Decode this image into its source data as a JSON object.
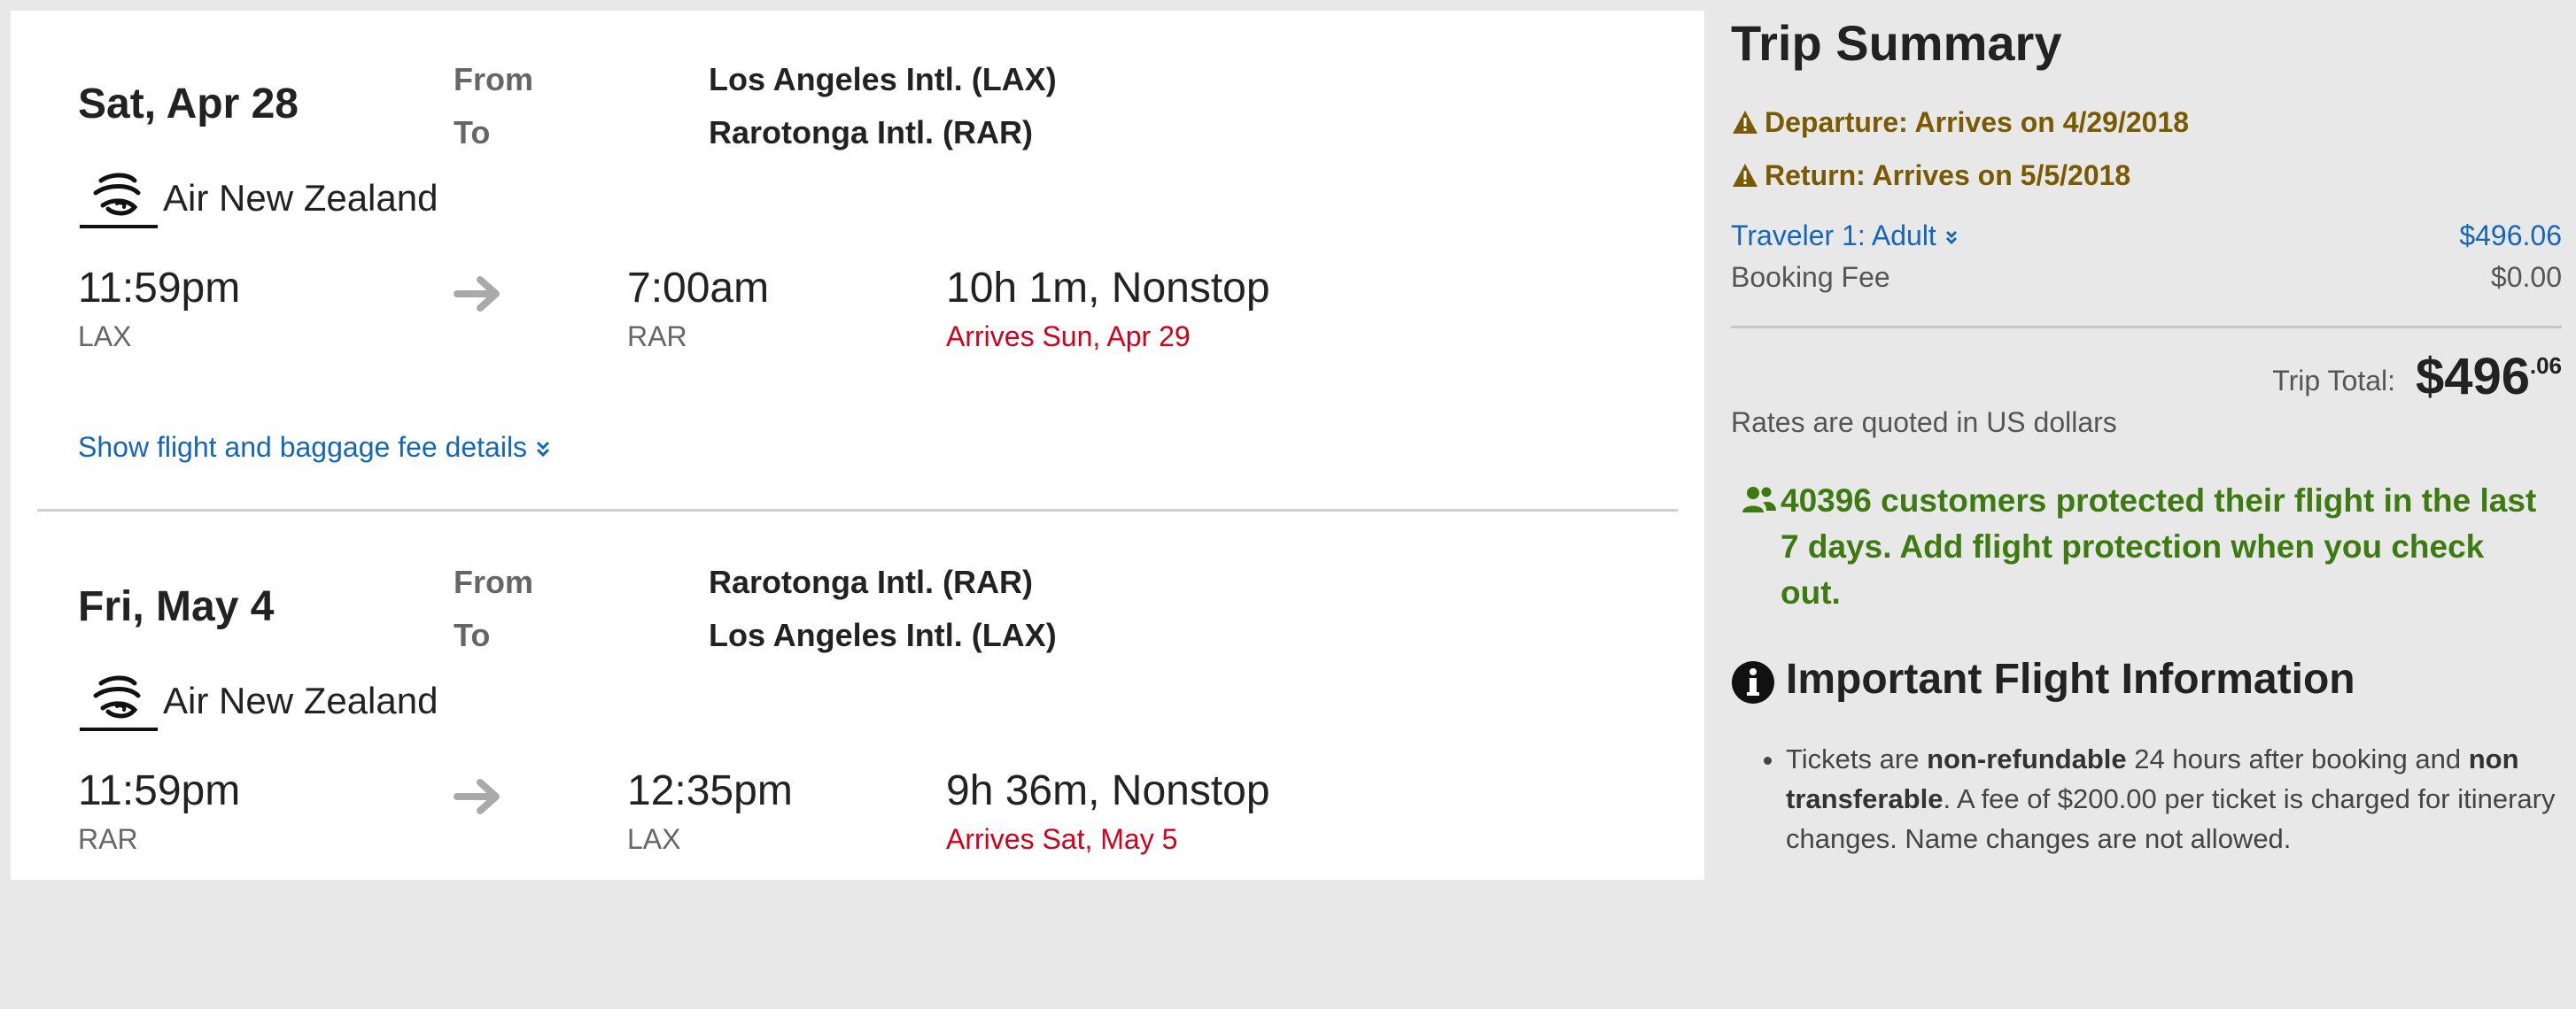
{
  "legs": [
    {
      "date": "Sat, Apr 28",
      "from_label": "From",
      "to_label": "To",
      "from_airport": "Los Angeles Intl. (LAX)",
      "to_airport": "Rarotonga Intl. (RAR)",
      "airline": "Air New Zealand",
      "airline_logo_icon": "air-new-zealand-koru-logo",
      "depart_time": "11:59pm",
      "depart_code": "LAX",
      "arrow_icon": "arrow-right-icon",
      "arrive_time": "7:00am",
      "arrive_code": "RAR",
      "duration": "10h 1m, Nonstop",
      "arrives_note": "Arrives Sun, Apr 29",
      "details_link": "Show flight and baggage fee details"
    },
    {
      "date": "Fri, May 4",
      "from_label": "From",
      "to_label": "To",
      "from_airport": "Rarotonga Intl. (RAR)",
      "to_airport": "Los Angeles Intl. (LAX)",
      "airline": "Air New Zealand",
      "airline_logo_icon": "air-new-zealand-koru-logo",
      "depart_time": "11:59pm",
      "depart_code": "RAR",
      "arrow_icon": "arrow-right-icon",
      "arrive_time": "12:35pm",
      "arrive_code": "LAX",
      "duration": "9h 36m, Nonstop",
      "arrives_note": "Arrives Sat, May 5"
    }
  ],
  "summary": {
    "title": "Trip Summary",
    "warnings": [
      "Departure: Arrives on 4/29/2018",
      "Return: Arrives on 5/5/2018"
    ],
    "traveler_label": "Traveler 1: Adult",
    "traveler_price": "$496.06",
    "booking_fee_label": "Booking Fee",
    "booking_fee_price": "$0.00",
    "total_label": "Trip Total:",
    "total_dollars": "$496",
    "total_cents": ".06",
    "rates_note": "Rates are quoted in US dollars",
    "protection_message": "40396 customers protected their flight in the last 7 days. Add flight protection when you check out."
  },
  "important_info": {
    "title": "Important Flight Information",
    "bullet_parts": [
      "Tickets are ",
      "non-refundable",
      " 24 hours after booking and ",
      "non transferable",
      ". A fee of $200.00 per ticket is charged for itinerary changes. Name changes are not allowed."
    ]
  },
  "colors": {
    "link_blue": "#1466b8",
    "arrival_red": "#d0021b",
    "warning_brown": "#7a5a00",
    "protect_green": "#3d7a12",
    "sidebar_bg": "#e8e8e8"
  },
  "icons": [
    "warning-triangle-icon",
    "chevron-double-down-icon",
    "users-icon",
    "info-circle-icon",
    "arrow-right-icon",
    "air-new-zealand-koru-logo"
  ]
}
